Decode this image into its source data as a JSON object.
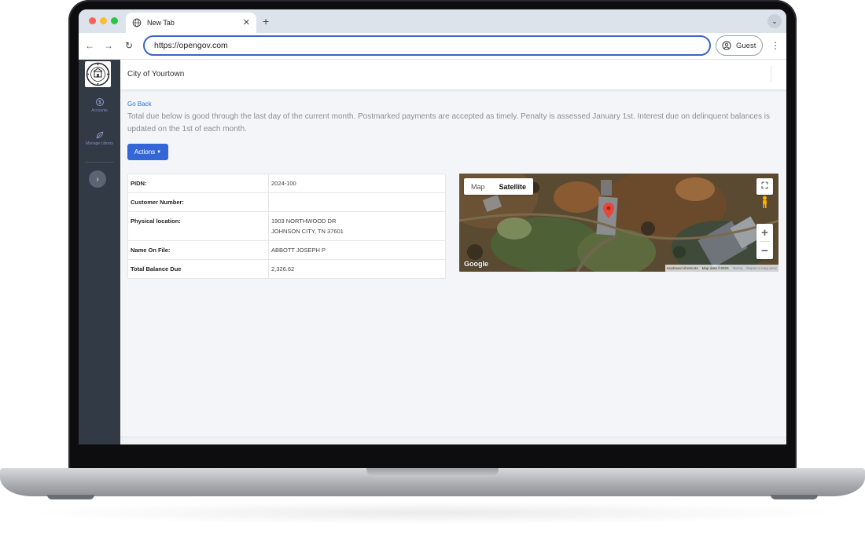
{
  "browser": {
    "tab_title": "New Tab",
    "new_tab_label": "+",
    "url": "https://opengov.com",
    "guest_label": "Guest",
    "back_glyph": "←",
    "forward_glyph": "→",
    "reload_glyph": "↻",
    "menu_glyph": "⋮",
    "tabbar_menu_glyph": "⌄",
    "close_glyph": "✕"
  },
  "sidebar": {
    "logo_text": "YOUR TOWN",
    "items": [
      {
        "label": "Accounts",
        "icon": "dollar-circle-icon"
      },
      {
        "label": "Manage Library",
        "icon": "leaf-icon"
      }
    ],
    "toggle_glyph": "›"
  },
  "header": {
    "title": "City of Yourtown"
  },
  "main": {
    "go_back": "Go Back",
    "notice": "Total due below is good through the last day of the current month. Postmarked payments are accepted as timely. Penalty is assessed January 1st. Interest due on delinquent balances is updated on the 1st of each month.",
    "actions_label": "Actions",
    "details": [
      {
        "key": "PIDN:",
        "value": "2024-100"
      },
      {
        "key": "Customer Number:",
        "value": ""
      },
      {
        "key": "Physical location:",
        "value": "1903 NORTHWOOD DR",
        "value2": "JOHNSON CITY, TN 37601"
      },
      {
        "key": "Name On File:",
        "value": "ABBOTT JOSEPH P"
      },
      {
        "key": "Total Balance Due",
        "value": "2,326.62"
      }
    ]
  },
  "map": {
    "tab_map": "Map",
    "tab_satellite": "Satellite",
    "zoom_in": "+",
    "zoom_out": "−",
    "google": "Google",
    "attrib_shortcuts": "Keyboard shortcuts",
    "attrib_data": "Map data ©2025",
    "attrib_terms": "Terms",
    "attrib_report": "Report a map error"
  },
  "colors": {
    "accent": "#3566d8",
    "sidebar_bg": "#323a46",
    "link": "#2f6bdb"
  }
}
